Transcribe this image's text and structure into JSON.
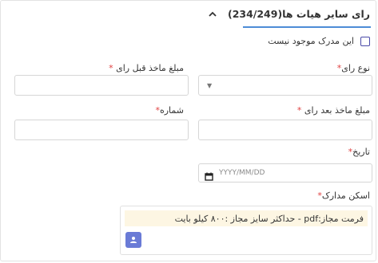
{
  "section": {
    "title": "رای سایر هیات ها(234/249)",
    "collapse_icon": "chevron-up-icon",
    "accent_color": "#4d8cd6"
  },
  "form": {
    "no_document_label": "این مدرک موجود نیست",
    "no_document_checked": false,
    "vote_type_label": "نوع رای",
    "amount_before_label": "مبلغ ماخذ قبل رای",
    "amount_after_label": "مبلغ ماخذ بعد رای",
    "number_label": "شماره",
    "date_label": "تاریخ",
    "date_placeholder": "YYYY/MM/DD",
    "scan_label": "اسکن مدارک",
    "required_mark": "*",
    "upload_note": "فرمت مجاز:pdf - حداکثر سایز مجاز :۸۰۰ کیلو بایت",
    "upload_icon": "upload-user-icon",
    "calendar_icon": "calendar-icon",
    "select_icon": "caret-down-icon"
  }
}
